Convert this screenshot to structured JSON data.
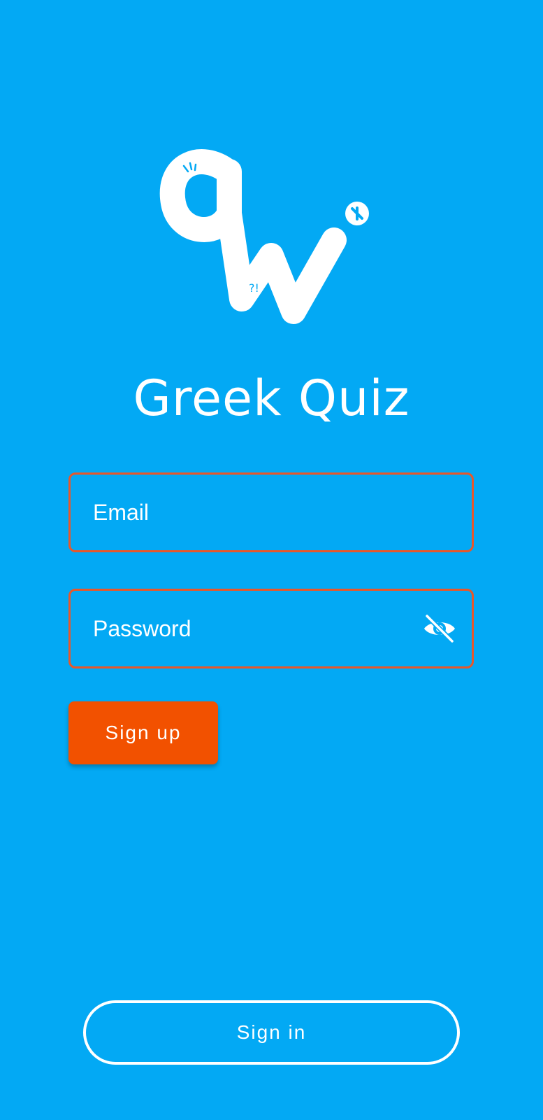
{
  "app": {
    "title": "Greek Quiz",
    "logo_icon": "greek-quiz-logo-icon"
  },
  "form": {
    "email_placeholder": "Email",
    "password_placeholder": "Password",
    "password_toggle_icon": "eye-off-icon"
  },
  "actions": {
    "sign_up_label": "Sign up",
    "sign_in_label": "Sign in"
  },
  "colors": {
    "background": "#03A9F4",
    "accent": "#F25100",
    "field_border": "#E8572A",
    "text": "#FFFFFF"
  }
}
